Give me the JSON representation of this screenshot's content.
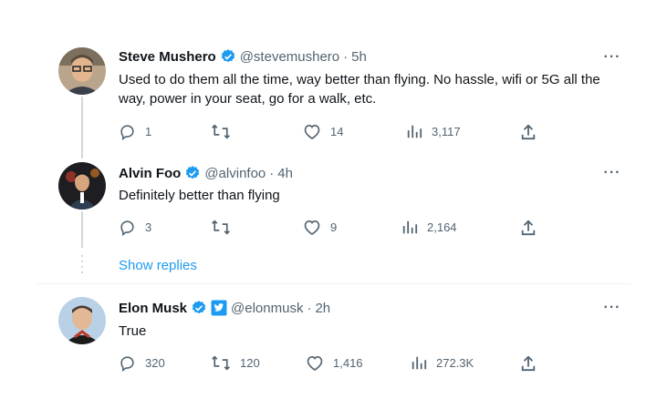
{
  "tweets": [
    {
      "name": "Steve Mushero",
      "handle": "@stevemushero",
      "time": "5h",
      "text": "Used to do them all the time, way better than flying. No hassle, wifi or 5G all the way, power in your seat, go for a walk, etc.",
      "replies": "1",
      "retweets": "",
      "likes": "14",
      "views": "3,117",
      "verified": true,
      "affiliate_badge": false
    },
    {
      "name": "Alvin Foo",
      "handle": "@alvinfoo",
      "time": "4h",
      "text": "Definitely better than flying",
      "replies": "3",
      "retweets": "",
      "likes": "9",
      "views": "2,164",
      "verified": true,
      "affiliate_badge": false
    },
    {
      "name": "Elon Musk",
      "handle": "@elonmusk",
      "time": "2h",
      "text": "True",
      "replies": "320",
      "retweets": "120",
      "likes": "1,416",
      "views": "272.3K",
      "verified": true,
      "affiliate_badge": true
    }
  ],
  "separator": "·",
  "more_label": "···",
  "show_replies": "Show replies",
  "icons": {
    "verified": "verified-badge-icon",
    "affiliate": "twitter-affiliate-icon",
    "more": "more-icon",
    "reply": "reply-icon",
    "retweet": "retweet-icon",
    "like": "heart-icon",
    "views": "views-icon",
    "share": "share-icon"
  },
  "colors": {
    "accent": "#1d9bf0",
    "text": "#0f1419",
    "muted": "#536471",
    "line": "#cfd9de"
  }
}
